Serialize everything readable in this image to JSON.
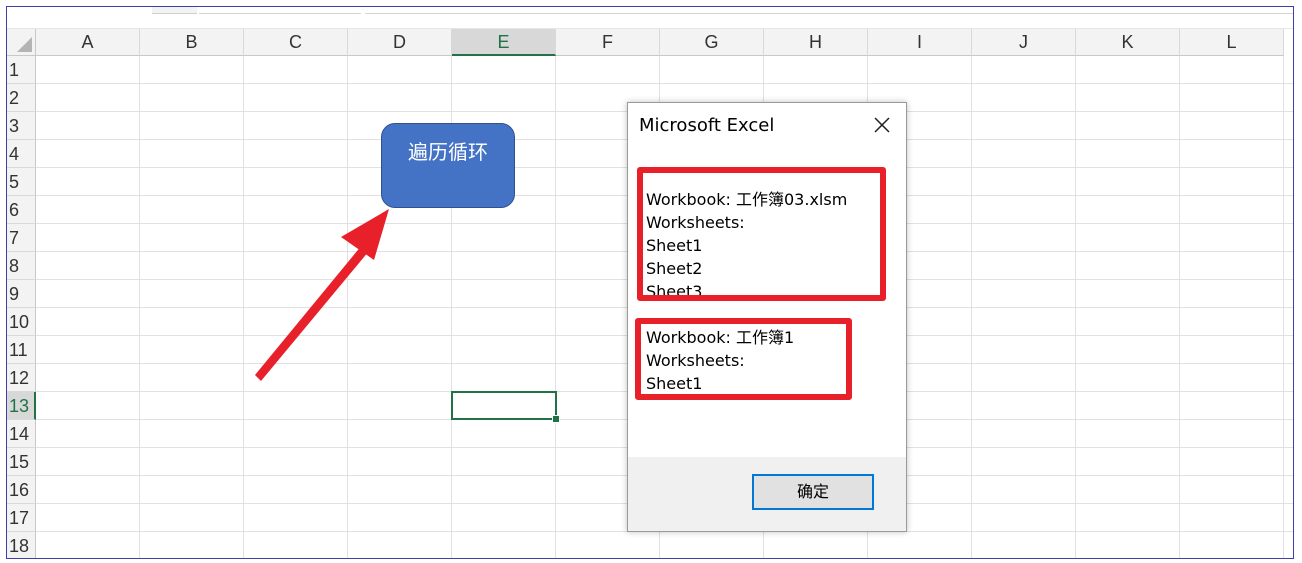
{
  "spreadsheet": {
    "columns": [
      "A",
      "B",
      "C",
      "D",
      "E",
      "F",
      "G",
      "H",
      "I",
      "J",
      "K",
      "L"
    ],
    "rows": [
      "1",
      "2",
      "3",
      "4",
      "5",
      "6",
      "7",
      "8",
      "9",
      "10",
      "11",
      "12",
      "13",
      "14",
      "15",
      "16",
      "17",
      "18"
    ],
    "active_column": "E",
    "active_row": "13",
    "accent_color": "#217346"
  },
  "shape_button": {
    "label": "遍历循环",
    "color": "#4472c4"
  },
  "annotation": {
    "arrow_color": "#e8202a",
    "highlight_color": "#e8202a"
  },
  "dialog": {
    "title": "Microsoft Excel",
    "close_icon": "close-icon",
    "message_groups": [
      {
        "lines": [
          "Workbook: 工作簿03.xlsm",
          "Worksheets:",
          "Sheet1",
          "Sheet2",
          "Sheet3"
        ]
      },
      {
        "lines": [
          "Workbook: 工作簿1",
          "Worksheets:",
          "Sheet1"
        ]
      }
    ],
    "ok_label": "确定"
  }
}
